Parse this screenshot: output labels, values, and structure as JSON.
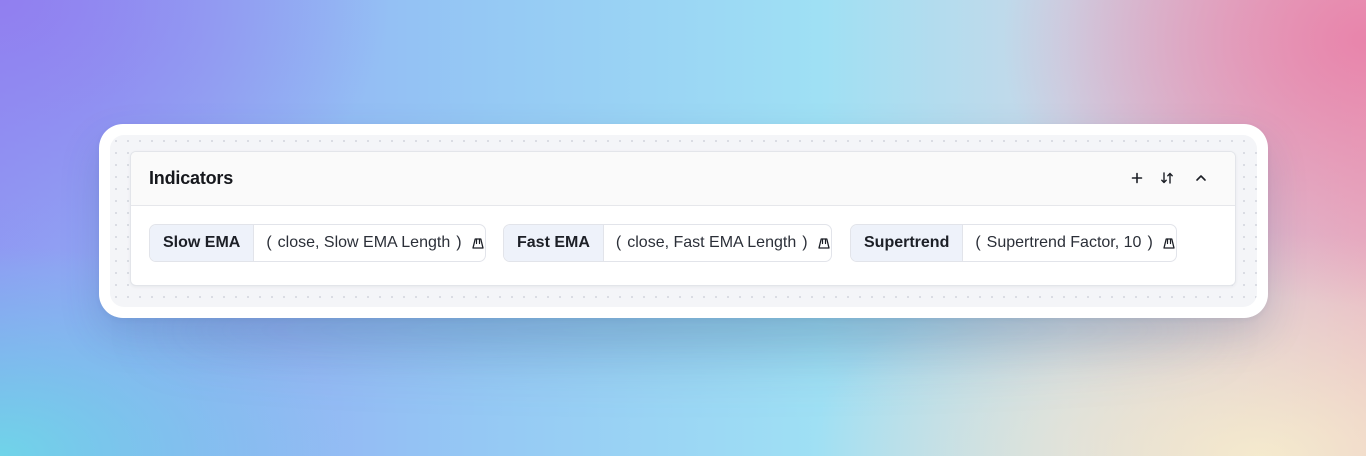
{
  "panel": {
    "title": "Indicators",
    "actions": [
      {
        "icon": "plus-icon"
      },
      {
        "icon": "sort-icon"
      },
      {
        "icon": "chevron-up-icon"
      }
    ]
  },
  "indicators": [
    {
      "name": "Slow EMA",
      "args": "close, Slow EMA Length",
      "open_paren": "(",
      "close_paren": ")",
      "icon": "settings-icon"
    },
    {
      "name": "Fast EMA",
      "args": "close, Fast EMA Length",
      "open_paren": "(",
      "close_paren": ")",
      "icon": "settings-icon"
    },
    {
      "name": "Supertrend",
      "args": "Supertrend Factor, 10",
      "open_paren": "(",
      "close_paren": ")",
      "icon": "settings-icon"
    }
  ]
}
